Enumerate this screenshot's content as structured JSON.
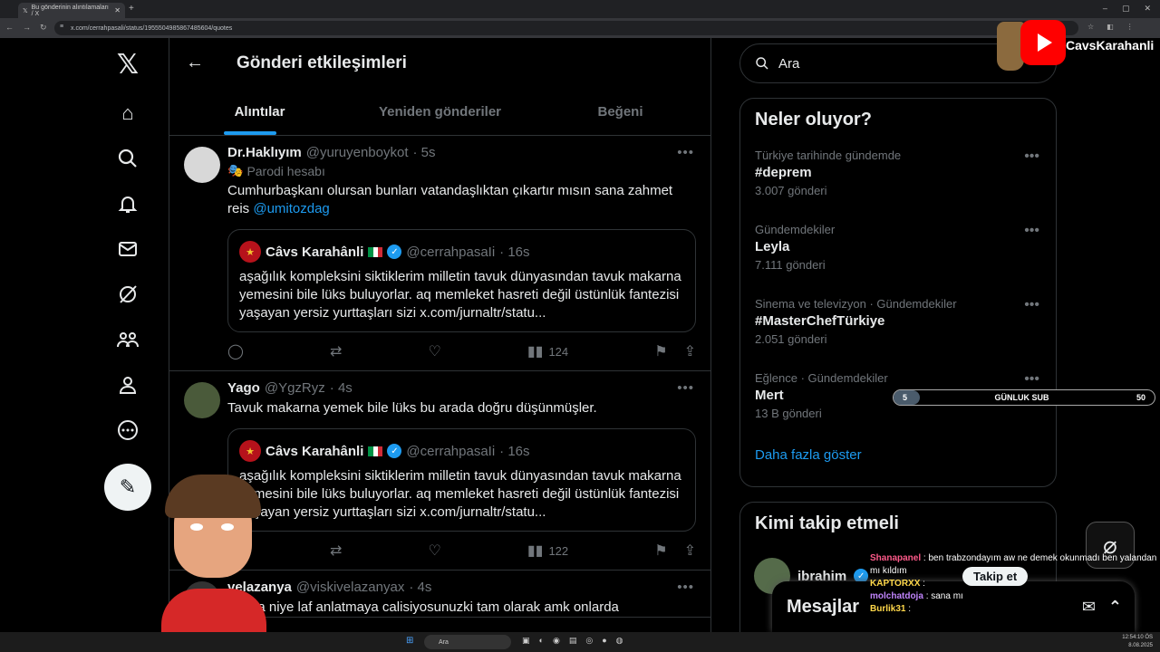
{
  "browser": {
    "tab_title": "Bu gönderinin alıntılamaları / X",
    "url": "x.com/cerrahpasali/status/1955504985867485604/quotes"
  },
  "header": {
    "title": "Gönderi etkileşimleri"
  },
  "tabs": [
    {
      "label": "Alıntılar"
    },
    {
      "label": "Yeniden gönderiler"
    },
    {
      "label": "Beğeni"
    }
  ],
  "posts": [
    {
      "name": "Dr.Haklıyım",
      "handle": "@yuruyenboykot",
      "time": "· 5s",
      "badge": "Parodi hesabı",
      "text": "Cumhurbaşkanı olursan bunları vatandaşlıktan çıkartır mısın sana zahmet reis ",
      "mention": "@umitozdag",
      "views": "124"
    },
    {
      "name": "Yago",
      "handle": "@YgzRyz",
      "time": "· 4s",
      "text": "Tavuk makarna yemek bile lüks bu arada doğru düşünmüşler.",
      "views": "122"
    },
    {
      "name": "velazanya",
      "handle": "@viskivelazanyax",
      "time": "· 4s",
      "text": "onlara niye laf anlatmaya calisiyosunuzki tam olarak amk onlarda"
    }
  ],
  "quote": {
    "name": "Câvs Karahânli",
    "handle": "@cerrahpasaIi",
    "time": "· 16s",
    "text": "aşağılık kompleksini siktiklerim milletin tavuk dünyasından tavuk makarna yemesini bile lüks buluyorlar. aq memleket hasreti değil üstünlük fantezisi yaşayan yersiz yurttaşları sizi x.com/jurnaltr/statu..."
  },
  "search": {
    "placeholder": "Ara"
  },
  "trends": {
    "title": "Neler oluyor?",
    "items": [
      {
        "category": "Türkiye tarihinde gündemde",
        "name": "#deprem",
        "count": "3.007 gönderi"
      },
      {
        "category": "Gündemdekiler",
        "name": "Leyla",
        "count": "7.111 gönderi"
      },
      {
        "category": "Sinema ve televizyon · Gündemdekiler",
        "name": "#MasterChefTürkiye",
        "count": "2.051 gönderi"
      },
      {
        "category": "Eğlence · Gündemdekiler",
        "name": "Mert",
        "count": "13 B gönderi"
      }
    ],
    "show_more": "Daha fazla göster"
  },
  "who_to_follow": {
    "title": "Kimi takip etmeli",
    "name": "ibrahim",
    "follow_label": "Takip et"
  },
  "messages": {
    "label": "Mesajlar"
  },
  "overlay": {
    "sub_left": "5",
    "sub_label": "GÜNLUK SUB",
    "sub_right": "50",
    "sub_progress": 0.1,
    "channel": "CavsKarahanli"
  },
  "chat": [
    {
      "user": "Shanapanel",
      "text": ": ben trabzondayım aw ne demek okunmadı ben yalandan mı kıldım"
    },
    {
      "user": "KAPTORXX",
      "text": ":"
    },
    {
      "user": "molchatdoja",
      "text": ": sana mı"
    },
    {
      "user": "Burlik31",
      "text": ":"
    }
  ],
  "taskbar": {
    "search_placeholder": "Ara",
    "time": "12:54:10 ÖS",
    "date": "8.08.2025"
  }
}
